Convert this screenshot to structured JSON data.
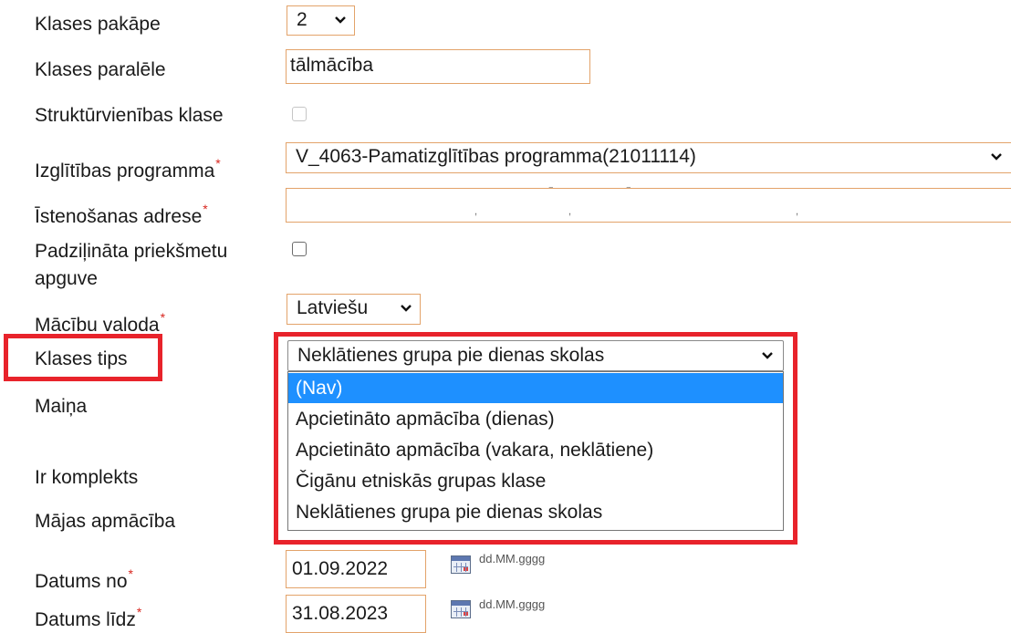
{
  "form": {
    "labels": {
      "klases_pakape": "Klases pakāpe",
      "klases_paralele": "Klases paralēle",
      "strukturvienibas": "Struktūrvienības klase",
      "izglitibas_programma": "Izglītības programma",
      "istenosanas_adrese": "Īstenošanas adrese",
      "padzilinata_1": "Padziļināta priekšmetu",
      "padzilinata_2": "apguve",
      "macibu_valoda": "Mācību valoda",
      "klases_tips": "Klases tips",
      "maina": "Maiņa",
      "ir_komplekts": "Ir komplekts",
      "majas_apmaciba": "Mājas apmācība",
      "datums_no": "Datums no",
      "datums_lidz": "Datums līdz"
    },
    "required_mark": "*",
    "klases_pakape_value": "2",
    "klases_paralele_value": "tālmācība",
    "izglitibas_programma_value": "V_4063-Pamatizglītības programma(21011114)",
    "macibu_valoda_value": "Latviešu",
    "klases_tips_value": "Neklātienes grupa pie dienas skolas",
    "klases_tips_options": [
      "(Nav)",
      "Apcietināto apmācība (dienas)",
      "Apcietināto apmācība (vakara, neklātiene)",
      "Čigānu etniskās grupas klase",
      "Neklātienes grupa pie dienas skolas"
    ],
    "datums_no_value": "01.09.2022",
    "datums_lidz_value": "31.08.2023",
    "date_format_hint": "dd.MM.gggg",
    "chevron": "⌄"
  },
  "colors": {
    "field_border": "#e3a36a",
    "highlight": "#e8232b",
    "selected_option": "#1e90ff",
    "required": "#d8261f"
  }
}
